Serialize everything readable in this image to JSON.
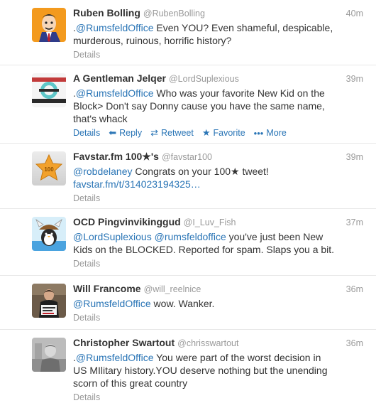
{
  "tweets": [
    {
      "name": "Ruben Bolling",
      "handle": "@RubenBolling",
      "time": "40m",
      "parts": [
        {
          "text": ".",
          "mention": false
        },
        {
          "text": "@RumsfeldOffice",
          "mention": true
        },
        {
          "text": " Even YOU? Even shameful, despicable,",
          "mention": false
        }
      ],
      "lines_after": [
        "murderous, ruinous, horrific history?"
      ],
      "details": "Details"
    },
    {
      "name": "A Gentleman Jelqer",
      "handle": "@LordSuplexious",
      "time": "39m",
      "parts": [
        {
          "text": ".",
          "mention": false
        },
        {
          "text": "@RumsfeldOffice",
          "mention": true
        },
        {
          "text": " Who was your favorite New Kid on the",
          "mention": false
        }
      ],
      "lines_after": [
        "Block> Don't say Donny cause you have the same name,",
        "that's whack"
      ],
      "details": "Details",
      "actions": {
        "reply": "Reply",
        "retweet": "Retweet",
        "favorite": "Favorite",
        "more": "More"
      }
    },
    {
      "name": "Favstar.fm 100★'s",
      "handle": "@favstar100",
      "time": "39m",
      "parts": [
        {
          "text": "@robdelaney",
          "mention": true
        },
        {
          "text": " Congrats on your 100★ tweet!",
          "mention": false
        }
      ],
      "link": "favstar.fm/t/314023194325…",
      "details": "Details"
    },
    {
      "name": "OCD Pingvinvikinggud",
      "handle": "@I_Luv_Fish",
      "time": "37m",
      "parts": [
        {
          "text": "@LordSuplexious",
          "mention": true
        },
        {
          "text": " ",
          "mention": false
        },
        {
          "text": "@rumsfeldoffice",
          "mention": true
        },
        {
          "text": " you've just been New",
          "mention": false
        }
      ],
      "lines_after": [
        "Kids on the BLOCKED. Reported for spam. Slaps you a bit."
      ],
      "details": "Details"
    },
    {
      "name": "Will Francome",
      "handle": "@will_reelnice",
      "time": "36m",
      "parts": [
        {
          "text": "@RumsfeldOffice",
          "mention": true
        },
        {
          "text": " wow. Wanker.",
          "mention": false
        }
      ],
      "details": "Details"
    },
    {
      "name": "Christopher Swartout",
      "handle": "@chrisswartout",
      "time": "36m",
      "parts": [
        {
          "text": ".",
          "mention": false
        },
        {
          "text": "@RumsfeldOffice",
          "mention": true
        },
        {
          "text": " You were part of the worst decision in",
          "mention": false
        }
      ],
      "lines_after": [
        "US MIlitary history.YOU deserve nothing but the unending",
        "scorn of this great country"
      ],
      "details": "Details"
    }
  ],
  "avatar_badge": "100"
}
